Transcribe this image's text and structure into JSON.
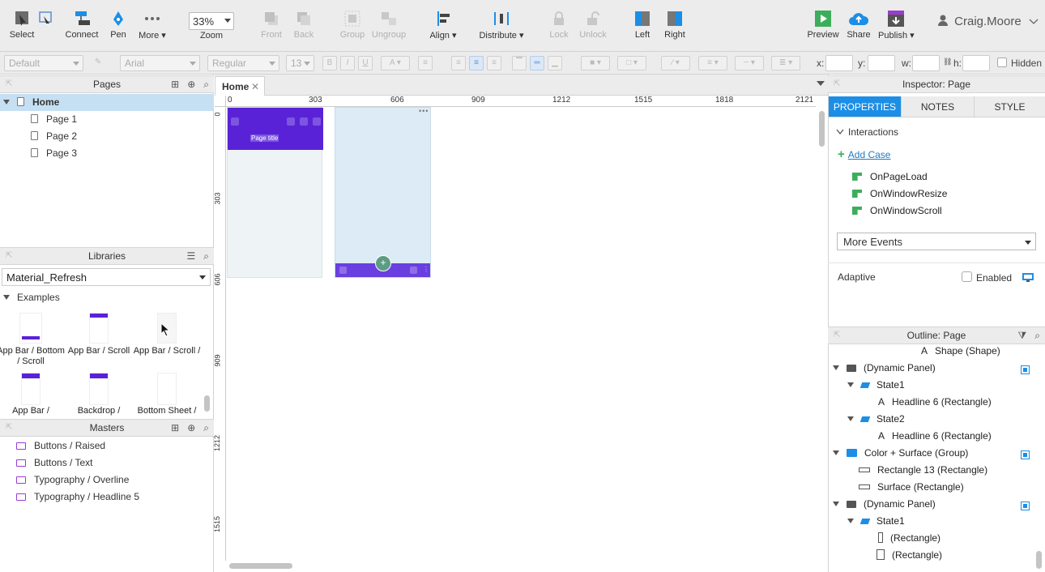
{
  "toolbar": {
    "select": "Select",
    "connect": "Connect",
    "pen": "Pen",
    "more": "More ▾",
    "zoom_value": "33%",
    "zoom_label": "Zoom",
    "front": "Front",
    "back": "Back",
    "group": "Group",
    "ungroup": "Ungroup",
    "align": "Align ▾",
    "distribute": "Distribute ▾",
    "lock": "Lock",
    "unlock": "Unlock",
    "left": "Left",
    "right": "Right",
    "preview": "Preview",
    "share": "Share",
    "publish": "Publish ▾",
    "user": "Craig.Moore"
  },
  "format": {
    "style": "Default",
    "font": "Arial",
    "weight": "Regular",
    "size": "13",
    "x_label": "x:",
    "y_label": "y:",
    "w_label": "w:",
    "h_label": "h:",
    "hidden_label": "Hidden"
  },
  "pages": {
    "title": "Pages",
    "items": [
      "Home",
      "Page 1",
      "Page 2",
      "Page 3"
    ]
  },
  "libraries": {
    "title": "Libraries",
    "selected": "Material_Refresh",
    "section": "Examples",
    "thumbs": [
      "App Bar / Bottom / Scroll",
      "App Bar / Scroll",
      "App Bar / Scroll /",
      "App Bar /",
      "Backdrop /",
      "Bottom Sheet /"
    ]
  },
  "masters": {
    "title": "Masters",
    "items": [
      "Buttons / Raised",
      "Buttons / Text",
      "Typography / Overline",
      "Typography / Headline 5"
    ]
  },
  "canvas": {
    "tab": "Home",
    "ruler_h": [
      "0",
      "303",
      "606",
      "909",
      "1212",
      "1515",
      "1818",
      "2121"
    ],
    "ruler_v": [
      "0",
      "303",
      "606",
      "909",
      "1212",
      "1515"
    ],
    "page_title": "Page title"
  },
  "inspector": {
    "title": "Inspector: Page",
    "tabs": [
      "PROPERTIES",
      "NOTES",
      "STYLE"
    ],
    "interactions": "Interactions",
    "add_case": "Add Case",
    "events": [
      "OnPageLoad",
      "OnWindowResize",
      "OnWindowScroll"
    ],
    "more_events": "More Events",
    "adaptive": "Adaptive",
    "enabled": "Enabled"
  },
  "outline": {
    "title": "Outline: Page",
    "rows": [
      "Shape (Shape)",
      "(Dynamic Panel)",
      "State1",
      "Headline 6 (Rectangle)",
      "State2",
      "Headline 6 (Rectangle)",
      "Color + Surface (Group)",
      "Rectangle 13 (Rectangle)",
      "Surface (Rectangle)",
      "(Dynamic Panel)",
      "State1",
      "(Rectangle)",
      "(Rectangle)"
    ]
  },
  "colors": {
    "accent": "#1c8ee6",
    "appbar": "#5a22d6",
    "panel_bg": "#dcebf5"
  }
}
